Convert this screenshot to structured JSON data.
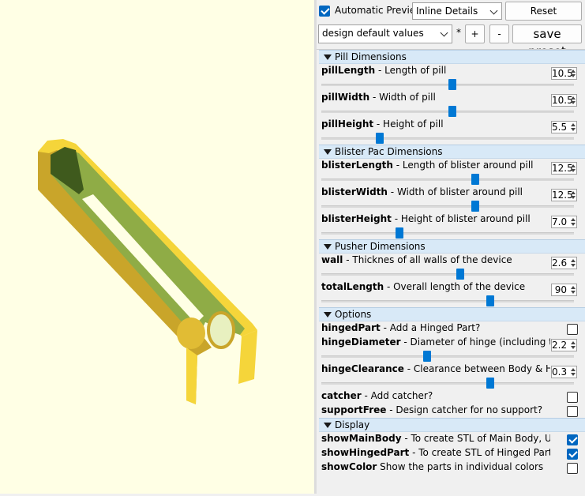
{
  "toolbar": {
    "auto_preview_label": "Automatic Preview",
    "auto_preview_checked": true,
    "view_mode": "Inline Details",
    "reset_label": "Reset",
    "preset_value": "design default values",
    "preset_modified_marker": "*",
    "add_label": "+",
    "remove_label": "-",
    "save_preset_label": "save preset"
  },
  "groups": [
    {
      "title": "Pill Dimensions",
      "params": [
        {
          "name": "pillLength",
          "desc": " - Length of pill",
          "value": "10.5",
          "slider": 0.52
        },
        {
          "name": "pillWidth",
          "desc": " - Width of pill",
          "value": "10.5",
          "slider": 0.52
        },
        {
          "name": "pillHeight",
          "desc": " - Height of pill",
          "value": "5.5",
          "slider": 0.23
        }
      ]
    },
    {
      "title": "Blister Pac Dimensions",
      "params": [
        {
          "name": "blisterLength",
          "desc": " - Length of blister around pill",
          "value": "12.5",
          "slider": 0.61
        },
        {
          "name": "blisterWidth",
          "desc": " - Width of blister around pill",
          "value": "12.5",
          "slider": 0.61
        },
        {
          "name": "blisterHeight",
          "desc": " - Height of blister around pill",
          "value": "7.0",
          "slider": 0.31
        }
      ]
    },
    {
      "title": "Pusher Dimensions",
      "params": [
        {
          "name": "wall",
          "desc": " - Thicknes of all walls of the device",
          "value": "2.6",
          "slider": 0.55
        },
        {
          "name": "totalLength",
          "desc": " - Overall length of the device",
          "value": "90",
          "slider": 0.67
        }
      ]
    },
    {
      "title": "Options",
      "params": [
        {
          "name": "hingedPart",
          "desc": " - Add a Hinged Part?",
          "checkbox": true,
          "checked": false
        },
        {
          "name": "hingeDiameter",
          "desc": " - Diameter of hinge (including tolerance)",
          "value": "2.2",
          "slider": 0.42
        },
        {
          "name": "hingeClearance",
          "desc": " - Clearance between Body & Hinged Par",
          "value": "0.3",
          "slider": 0.67
        },
        {
          "name": "catcher",
          "desc": " - Add catcher?",
          "checkbox": true,
          "checked": false
        },
        {
          "name": "supportFree",
          "desc": " - Design catcher for no support?",
          "checkbox": true,
          "checked": false
        }
      ]
    },
    {
      "title": "Display",
      "params": [
        {
          "name": "showMainBody",
          "desc": " - To create STL of Main Body, UNCHECK oth",
          "checkbox": true,
          "checked": true
        },
        {
          "name": "showHingedPart",
          "desc": " - To create STL of Hinged Part, UNCHECK",
          "checkbox": true,
          "checked": true
        },
        {
          "name": "showColor",
          "desc": " Show the parts in individual colors",
          "checkbox": true,
          "checked": false
        }
      ]
    }
  ],
  "model_colors": {
    "background": "#ffffe5",
    "body_face": "#f5d53a",
    "body_side": "#c9a52a",
    "inner": "#8fac46",
    "inner_dark": "#3f5a1d"
  }
}
